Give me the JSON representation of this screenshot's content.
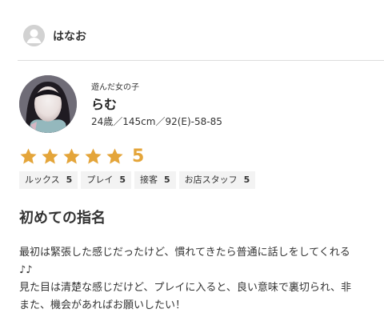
{
  "reviewer": {
    "name": "はなお",
    "icon": "user-avatar-icon"
  },
  "girl": {
    "label": "遊んだ女の子",
    "name": "らむ",
    "stats": "24歳／145cm／92(E)-58-85"
  },
  "rating": {
    "stars": 5,
    "max": 5,
    "score": "5",
    "star_color": "#e4a53a"
  },
  "subscores": [
    {
      "label": "ルックス",
      "value": "5"
    },
    {
      "label": "プレイ",
      "value": "5"
    },
    {
      "label": "接客",
      "value": "5"
    },
    {
      "label": "お店スタッフ",
      "value": "5"
    }
  ],
  "review": {
    "title": "初めての指名",
    "lines": [
      "最初は緊張した感じだったけど、慣れてきたら普通に話しをしてくれる",
      "♪♪",
      "見た目は清楚な感じだけど、プレイに入ると、良い意味で裏切られ、非",
      "また、機会があればお願いしたい！"
    ]
  }
}
